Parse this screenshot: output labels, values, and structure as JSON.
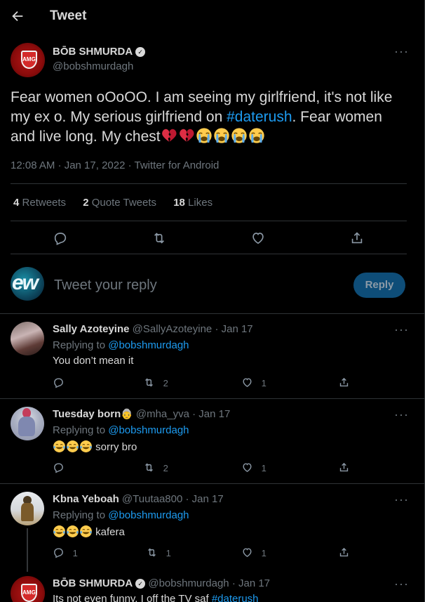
{
  "header": {
    "title": "Tweet"
  },
  "main_tweet": {
    "author_name": "BŌB SHMURDA",
    "author_handle": "@bobshmurdagh",
    "avatar_text": "AMG",
    "text_before": "Fear women oOoOO. I am seeing my girlfriend, it's not like my ex o. My serious girlfriend on ",
    "hashtag": "#daterush",
    "text_after": ". Fear women and live long. My chest",
    "emojis": [
      "broken-heart",
      "broken-heart",
      "loudly-crying",
      "loudly-crying",
      "loudly-crying",
      "loudly-crying"
    ],
    "timestamp": "12:08 AM · Jan 17, 2022 · Twitter for Android",
    "stats": {
      "retweets_count": "4",
      "retweets_label": "Retweets",
      "quotes_count": "2",
      "quotes_label": "Quote Tweets",
      "likes_count": "18",
      "likes_label": "Likes"
    }
  },
  "composer": {
    "avatar_text": "ew",
    "placeholder": "Tweet your reply",
    "button_label": "Reply"
  },
  "replies": [
    {
      "name": "Sally Azoteyine",
      "handle": "@SallyAzoteyine",
      "date": "· Jan 17",
      "replying_label": "Replying to",
      "replying_to": "@bobshmurdagh",
      "text": "You don’t mean it",
      "emojis": [],
      "reply_count": "",
      "retweet_count": "2",
      "like_count": "1"
    },
    {
      "name": "Tuesday born",
      "handle": "@mha_yva",
      "date": "· Jan 17",
      "replying_label": "Replying to",
      "replying_to": "@bobshmurdagh",
      "text": "sorry bro",
      "emojis": [
        "joy",
        "joy",
        "joy"
      ],
      "reply_count": "",
      "retweet_count": "2",
      "like_count": "1"
    },
    {
      "name": "Kbna Yeboah",
      "handle": "@Tuutaa800",
      "date": "· Jan 17",
      "replying_label": "Replying to",
      "replying_to": "@bobshmurdagh",
      "text": "kafera",
      "emojis": [
        "joy",
        "joy",
        "joy"
      ],
      "reply_count": "1",
      "retweet_count": "1",
      "like_count": "1"
    },
    {
      "name": "BŌB SHMURDA",
      "handle": "@bobshmurdagh",
      "date": "· Jan 17",
      "text_before": "Its not even funny. I off the TV saf ",
      "hashtag": "#daterush"
    }
  ],
  "colors": {
    "accent": "#1d9bf0",
    "muted": "#6e767d",
    "text": "#d9d9d9",
    "background": "#000000"
  }
}
